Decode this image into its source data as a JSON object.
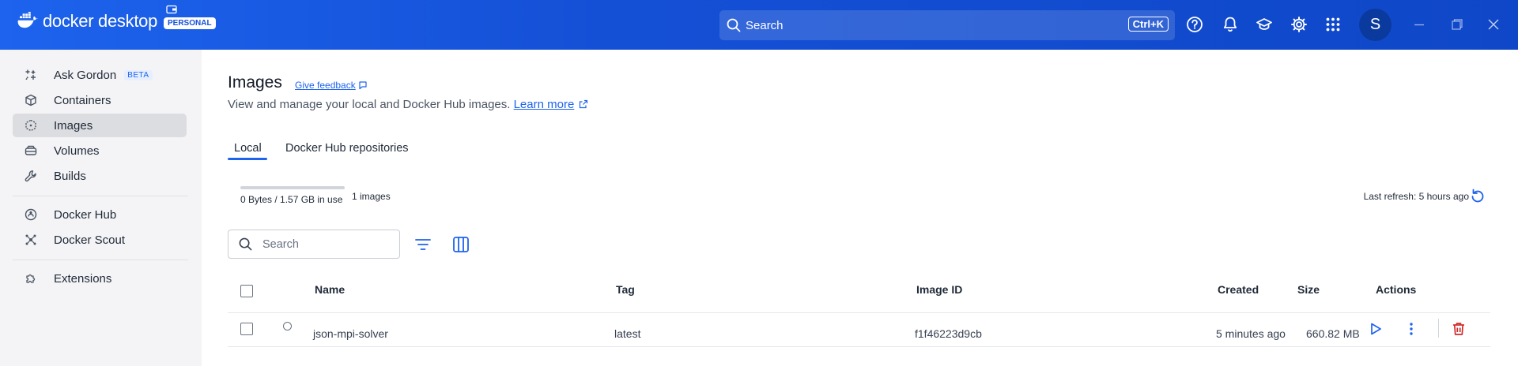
{
  "header": {
    "logo_text": "docker desktop",
    "plan_badge": "PERSONAL",
    "search_placeholder": "Search",
    "search_shortcut": "Ctrl+K",
    "user_initial": "S",
    "brand_color": "#1d63ed"
  },
  "sidebar": {
    "items": [
      {
        "label": "Ask Gordon",
        "badge": "BETA",
        "icon": "sparkle-icon"
      },
      {
        "label": "Containers",
        "icon": "container-icon"
      },
      {
        "label": "Images",
        "icon": "image-icon",
        "active": true
      },
      {
        "label": "Volumes",
        "icon": "volume-icon"
      },
      {
        "label": "Builds",
        "icon": "wrench-icon"
      },
      {
        "label": "Docker Hub",
        "icon": "hub-icon"
      },
      {
        "label": "Docker Scout",
        "icon": "scout-icon"
      },
      {
        "label": "Extensions",
        "icon": "puzzle-icon"
      }
    ]
  },
  "main": {
    "title": "Images",
    "feedback_link": "Give feedback",
    "subtitle": "View and manage your local and Docker Hub images.",
    "learn_more": "Learn more",
    "tabs": [
      {
        "label": "Local",
        "active": true
      },
      {
        "label": "Docker Hub repositories"
      }
    ],
    "usage": {
      "text": "0 Bytes / 1.57 GB in use",
      "fraction": 0.0,
      "image_count": "1 images"
    },
    "last_refresh": "Last refresh: 5 hours ago",
    "table_search_placeholder": "Search",
    "columns": {
      "name": "Name",
      "tag": "Tag",
      "image_id": "Image ID",
      "created": "Created",
      "size": "Size",
      "actions": "Actions"
    },
    "rows": [
      {
        "name": "json-mpi-solver",
        "tag": "latest",
        "image_id": "f1f46223d9cb",
        "created": "5 minutes ago",
        "size": "660.82 MB"
      }
    ]
  }
}
